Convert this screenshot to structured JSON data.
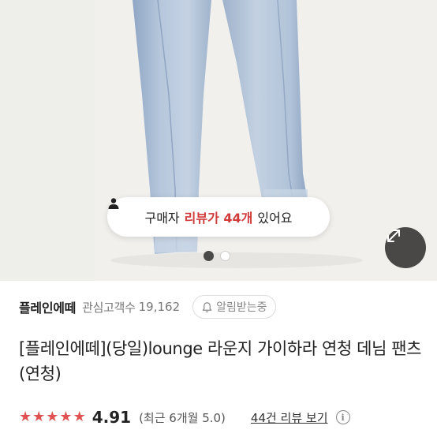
{
  "review_banner": {
    "prefix": "구매자",
    "highlight": "리뷰가 44개",
    "suffix": "있어요"
  },
  "carousel": {
    "current": 1,
    "total": 2
  },
  "store": {
    "name": "플레인에떼",
    "fans_label": "관심고객수",
    "fans_count": "19,162",
    "alarm_label": "알림받는중"
  },
  "product": {
    "title": "[플레인에떼](당일)lounge 라운지 가이하라 연청 데님 팬츠 (연청)"
  },
  "rating": {
    "stars": 5,
    "score": "4.91",
    "recent": "(최근 6개월 5.0)",
    "review_link": "44건 리뷰 보기",
    "info": "i"
  },
  "colors": {
    "accent": "#d13b3b",
    "star": "#e05252",
    "denim": "#a9bcd4"
  }
}
